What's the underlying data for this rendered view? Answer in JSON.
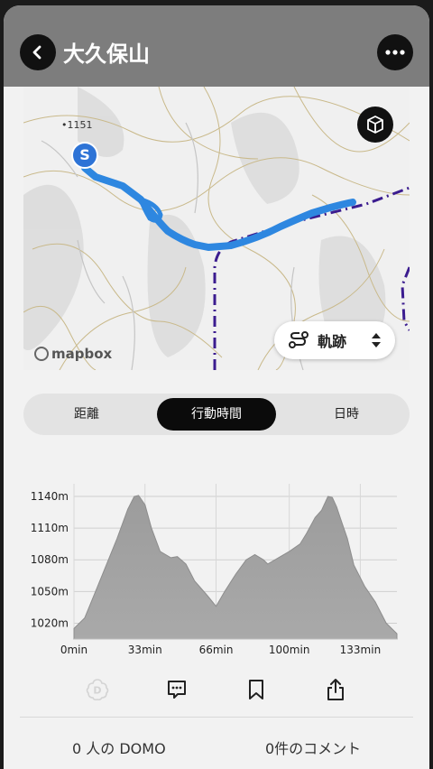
{
  "header": {
    "title": "大久保山",
    "back_icon": "chevron-left-icon",
    "more_icon": "ellipsis-icon"
  },
  "map": {
    "elevation_label": "•1151",
    "start_marker": "S",
    "attribution": "mapbox",
    "track_button_label": "軌跡",
    "cube_icon": "cube-3d-icon",
    "route_color": "#2e87e0",
    "boundary_color": "#3b1c8f"
  },
  "segment": {
    "items": [
      "距離",
      "行動時間",
      "日時"
    ],
    "selected": "行動時間"
  },
  "chart_data": {
    "type": "area",
    "y_ticks": [
      "1140m",
      "1110m",
      "1080m",
      "1050m",
      "1020m"
    ],
    "x_ticks": [
      "0min",
      "33min",
      "66min",
      "100min",
      "133min"
    ],
    "xlim": [
      0,
      150
    ],
    "ylim": [
      1005,
      1152
    ],
    "x": [
      0,
      5,
      10,
      15,
      20,
      25,
      28,
      30,
      33,
      36,
      40,
      45,
      48,
      52,
      56,
      62,
      66,
      70,
      75,
      80,
      84,
      88,
      90,
      95,
      100,
      105,
      108,
      112,
      115,
      118,
      120,
      122,
      124,
      127,
      130,
      135,
      140,
      145,
      150
    ],
    "y": [
      1015,
      1025,
      1050,
      1075,
      1100,
      1128,
      1140,
      1141,
      1132,
      1110,
      1088,
      1082,
      1083,
      1076,
      1060,
      1046,
      1036,
      1050,
      1066,
      1080,
      1085,
      1080,
      1076,
      1082,
      1088,
      1095,
      1105,
      1120,
      1127,
      1140,
      1139,
      1130,
      1118,
      1100,
      1075,
      1055,
      1040,
      1020,
      1010
    ],
    "fill_color": "#a9a9a9"
  },
  "toolbar": {
    "icons": [
      "domo-icon",
      "comment-icon",
      "bookmark-icon",
      "share-icon"
    ]
  },
  "stats": {
    "domo": "0 人の DOMO",
    "comments": "0件のコメント"
  }
}
